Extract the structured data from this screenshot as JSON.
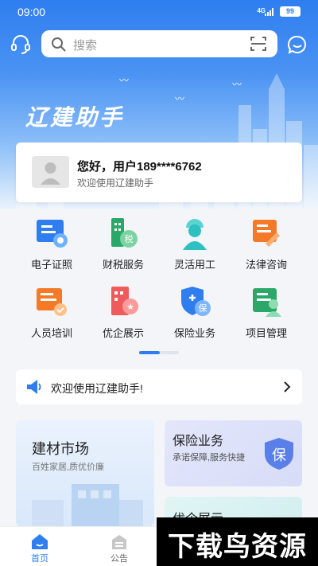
{
  "status_bar": {
    "time": "09:00",
    "network": "4G",
    "battery": "99"
  },
  "search": {
    "placeholder": "搜索"
  },
  "brand": {
    "title": "辽建助手"
  },
  "user": {
    "greeting": "您好，用户189****6762",
    "welcome": "欢迎使用辽建助手"
  },
  "services": [
    {
      "label": "电子证照",
      "icon": "certificate-icon",
      "color": "#2f7ef0"
    },
    {
      "label": "财税服务",
      "icon": "tax-icon",
      "color": "#2aa86a"
    },
    {
      "label": "灵活用工",
      "icon": "worker-icon",
      "color": "#2ec1c1"
    },
    {
      "label": "法律咨询",
      "icon": "law-icon",
      "color": "#f57a27"
    },
    {
      "label": "人员培训",
      "icon": "training-icon",
      "color": "#f57a27"
    },
    {
      "label": "优企展示",
      "icon": "enterprise-icon",
      "color": "#ef5a5a"
    },
    {
      "label": "保险业务",
      "icon": "insurance-icon",
      "color": "#2f7ef0"
    },
    {
      "label": "项目管理",
      "icon": "project-icon",
      "color": "#2aa86a"
    }
  ],
  "notice": {
    "text": "欢迎使用辽建助手!"
  },
  "cards": {
    "market": {
      "title": "建材市场",
      "subtitle": "百姓家居,质优价廉"
    },
    "insurance": {
      "title": "保险业务",
      "subtitle": "承诺保障,服务快捷",
      "badge": "保"
    },
    "showcase": {
      "title": "优企展示"
    }
  },
  "tabs": [
    {
      "label": "首页",
      "active": true
    },
    {
      "label": "公告",
      "active": false
    }
  ],
  "watermark": {
    "text": "下载鸟资源"
  },
  "colors": {
    "primary": "#2f7ef0",
    "background": "#f3f5f9"
  }
}
